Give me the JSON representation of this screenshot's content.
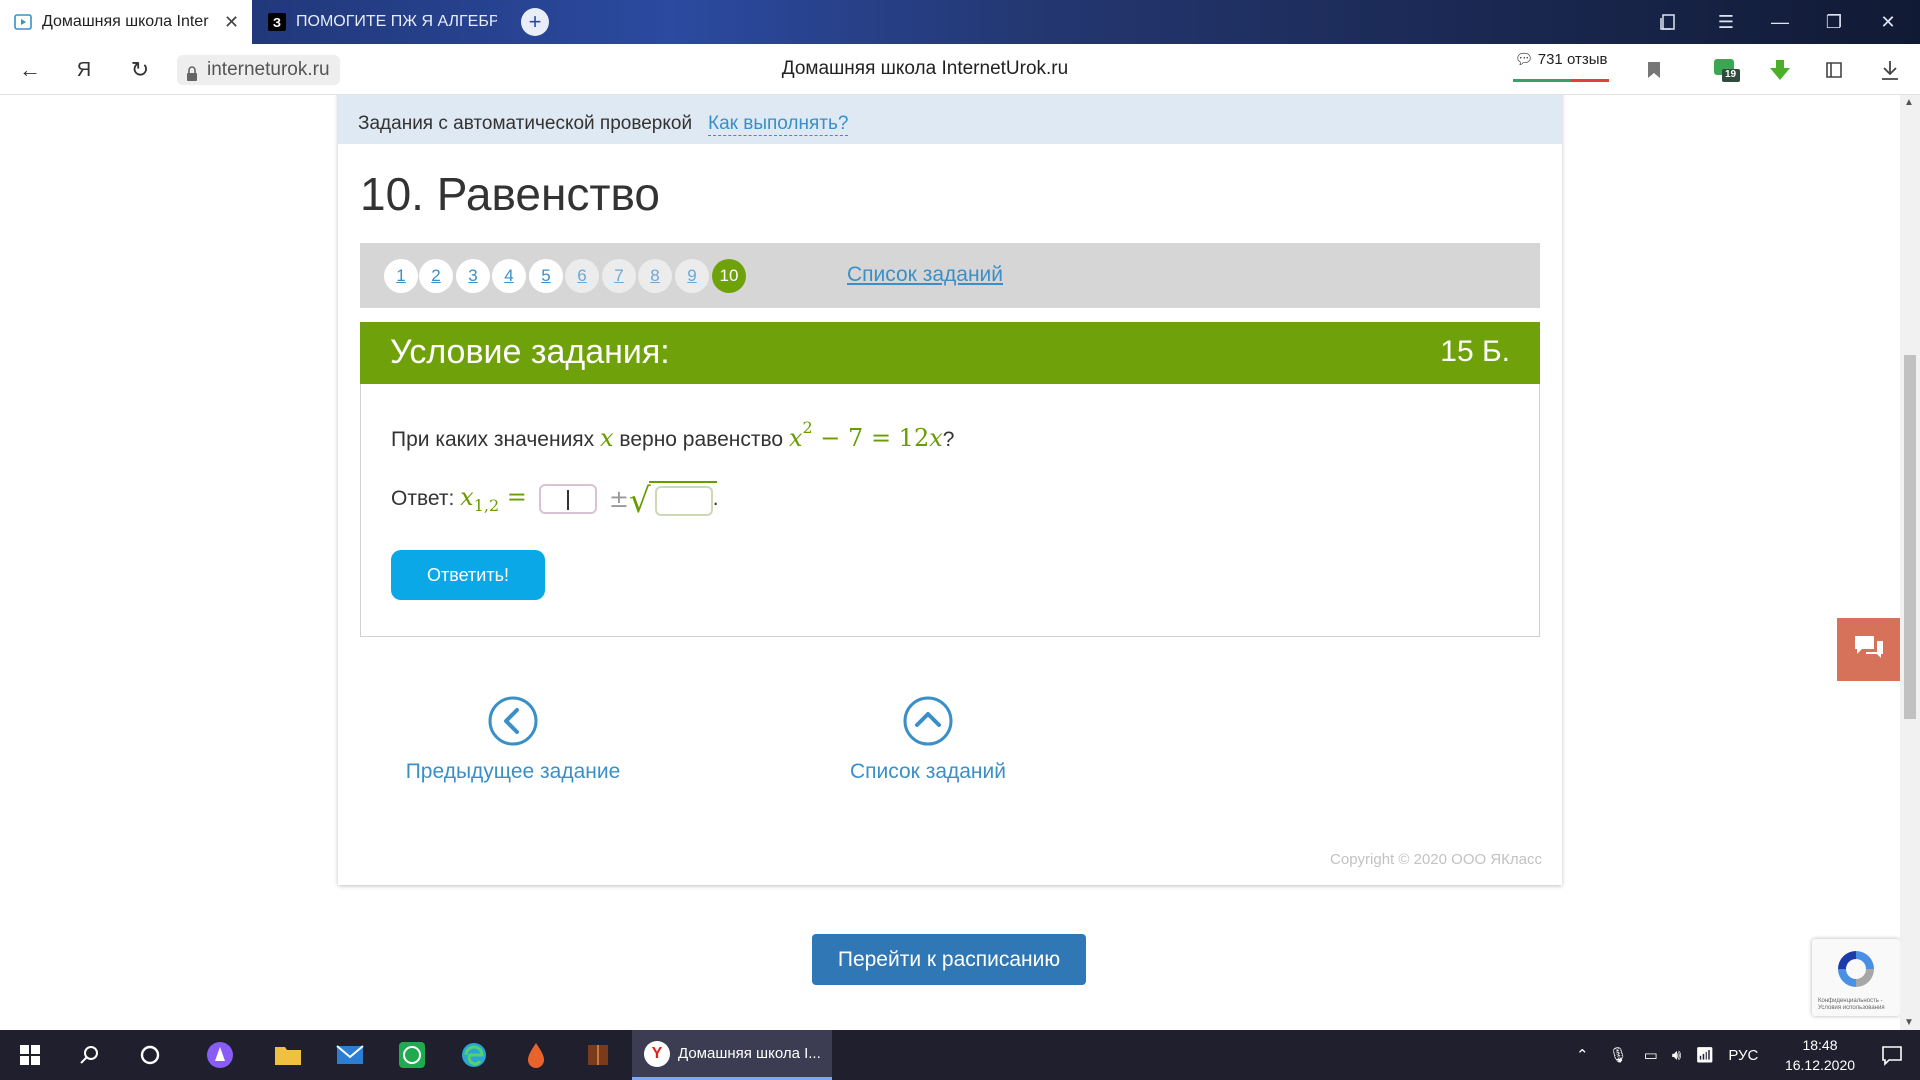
{
  "browser": {
    "tabs": [
      {
        "title": "Домашняя школа Inter",
        "active": true
      },
      {
        "title": "ПОМОГИТЕ ПЖ Я АЛГЕБР",
        "active": false
      }
    ],
    "new_tab": "+",
    "url": "interneturok.ru",
    "page_title": "Домашняя школа InternetUrok.ru",
    "reviews_label": "731 отзыв",
    "badge_count": "19"
  },
  "page": {
    "autocheck_text": "Задания с автоматической проверкой",
    "howto_link": "Как выполнять?",
    "task_title": "10. Равенство",
    "pager": {
      "items": [
        "1",
        "2",
        "3",
        "4",
        "5",
        "6",
        "7",
        "8",
        "9",
        "10"
      ],
      "current": "10",
      "list_link": "Список заданий"
    },
    "condition": {
      "title": "Условие задания:",
      "points": "15 Б.",
      "question_prefix": "При каких значениях",
      "question_var": "x",
      "question_mid": "верно равенство",
      "eq_base": "x",
      "eq_exp": "2",
      "eq_rest": " − 7 = 12",
      "eq_var": "x",
      "question_suffix": "?",
      "answer_label": "Ответ:",
      "answer_var": "x",
      "answer_sub": "1,2",
      "answer_eq": " =",
      "plus_minus": "±",
      "answer_end": ".",
      "submit": "Ответить!"
    },
    "nav": {
      "prev": "Предыдущее задание",
      "list": "Список заданий"
    },
    "copyright": "Copyright © 2020 ООО ЯКласс",
    "schedule_button": "Перейти к расписанию",
    "recaptcha_text": "Конфиденциальность - Условия использования"
  },
  "taskbar": {
    "active_window": "Домашняя школа I...",
    "language": "РУС",
    "time": "18:48",
    "date": "16.12.2020"
  },
  "colors": {
    "accent_green": "#6fa20a",
    "link_blue": "#3a8fc7",
    "button_blue": "#0aa8e6",
    "schedule_blue": "#2f77b5"
  }
}
